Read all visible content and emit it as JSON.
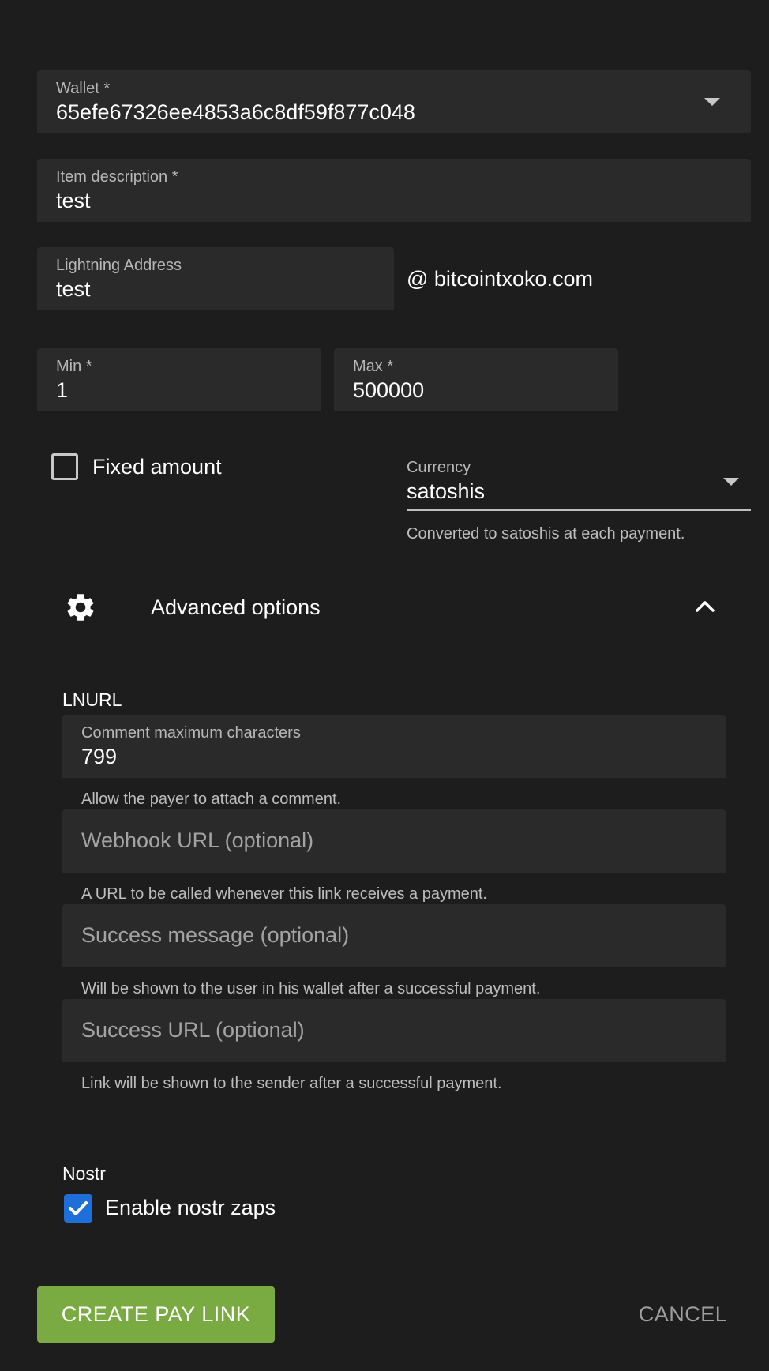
{
  "wallet": {
    "label": "Wallet *",
    "value": "65efe67326ee4853a6c8df59f877c048"
  },
  "description": {
    "label": "Item description *",
    "value": "test"
  },
  "lightning": {
    "label": "Lightning Address",
    "value": "test",
    "domain": "@ bitcointxoko.com"
  },
  "min": {
    "label": "Min *",
    "value": "1"
  },
  "max": {
    "label": "Max *",
    "value": "500000"
  },
  "fixed_amount": {
    "label": "Fixed amount",
    "checked": false
  },
  "currency": {
    "label": "Currency",
    "value": "satoshis",
    "hint": "Converted to satoshis at each payment."
  },
  "advanced": {
    "label": "Advanced options",
    "icon": "gear-icon",
    "expanded": true
  },
  "lnurl": {
    "section_label": "LNURL",
    "comment": {
      "label": "Comment maximum characters",
      "value": "799",
      "hint": "Allow the payer to attach a comment."
    },
    "webhook": {
      "placeholder": "Webhook URL (optional)",
      "hint": "A URL to be called whenever this link receives a payment."
    },
    "success_message": {
      "placeholder": "Success message (optional)",
      "hint": "Will be shown to the user in his wallet after a successful payment."
    },
    "success_url": {
      "placeholder": "Success URL (optional)",
      "hint": "Link will be shown to the sender after a successful payment."
    }
  },
  "nostr": {
    "section_label": "Nostr",
    "zaps_label": "Enable nostr zaps",
    "checked": true
  },
  "actions": {
    "create": "CREATE PAY LINK",
    "cancel": "CANCEL"
  },
  "colors": {
    "accent": "#7aab43",
    "checkbox": "#1e6fd9",
    "background": "#1d1d1d",
    "field": "#2a2a2a"
  }
}
